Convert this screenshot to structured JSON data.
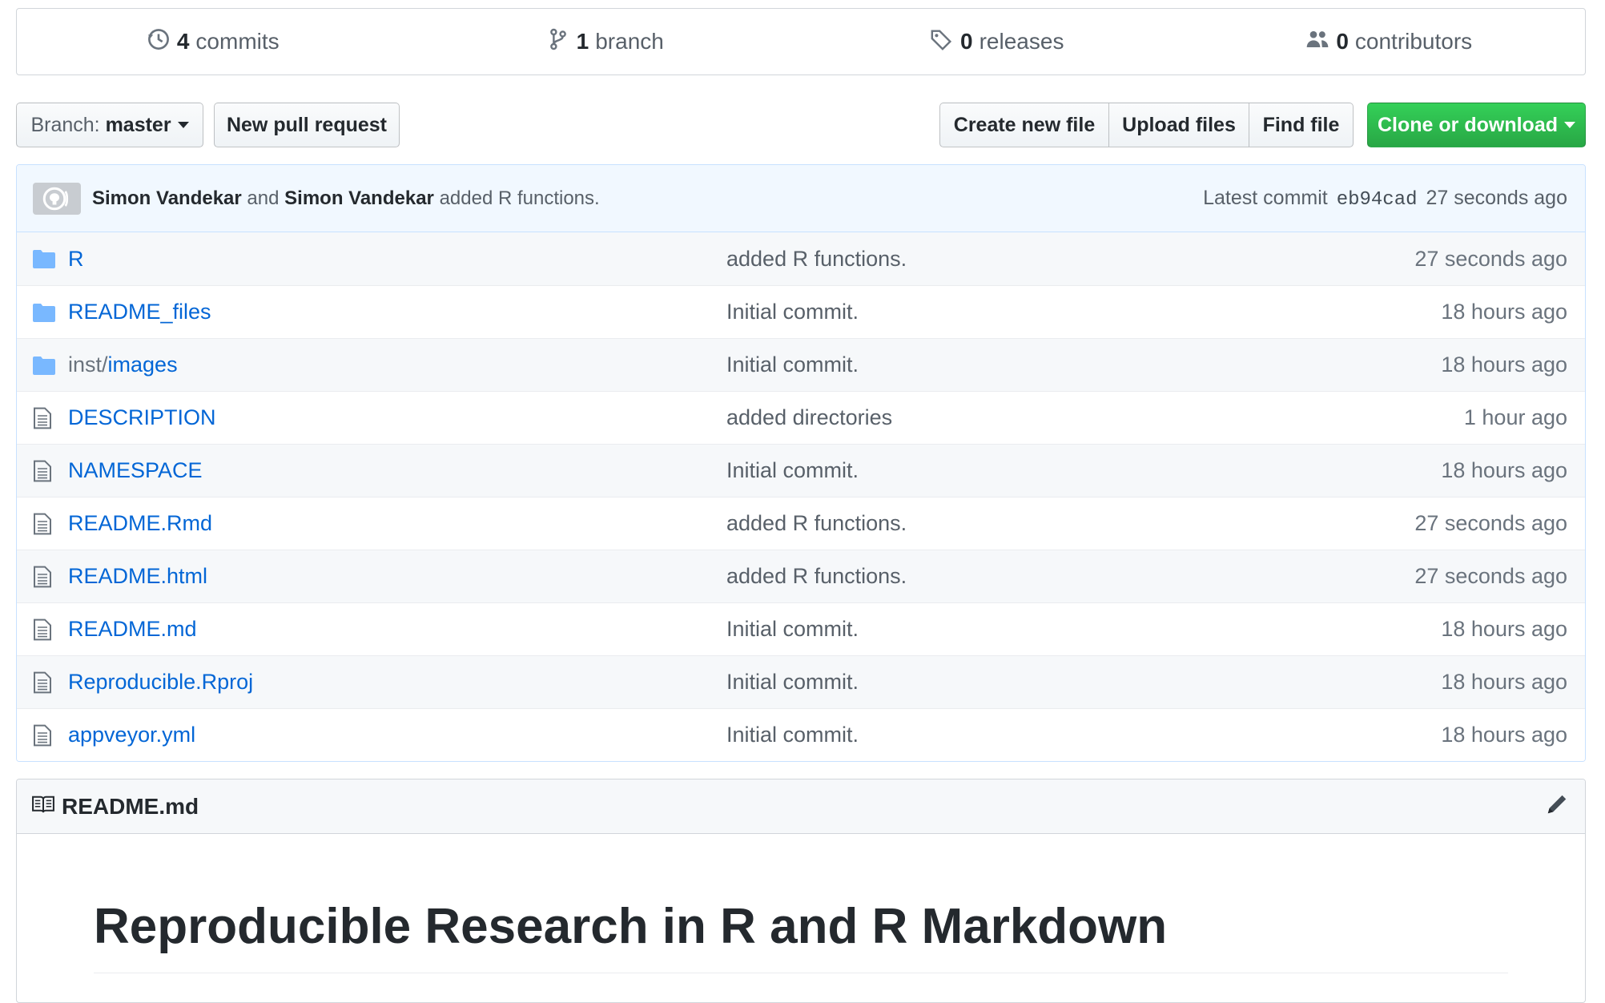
{
  "stats": {
    "commits": {
      "count": "4",
      "label": "commits"
    },
    "branches": {
      "count": "1",
      "label": "branch"
    },
    "releases": {
      "count": "0",
      "label": "releases"
    },
    "contributors": {
      "count": "0",
      "label": "contributors"
    }
  },
  "toolbar": {
    "branch_prefix": "Branch:",
    "branch_name": "master",
    "new_pull_request": "New pull request",
    "create_new_file": "Create new file",
    "upload_files": "Upload files",
    "find_file": "Find file",
    "clone_or_download": "Clone or download"
  },
  "latest_commit": {
    "author1": "Simon Vandekar",
    "conjunction": "and",
    "author2": "Simon Vandekar",
    "message": "added R functions.",
    "label": "Latest commit",
    "sha": "eb94cad",
    "age": "27 seconds ago"
  },
  "files": [
    {
      "type": "folder",
      "prefix": "",
      "name": "R",
      "message": "added R functions.",
      "age": "27 seconds ago"
    },
    {
      "type": "folder",
      "prefix": "",
      "name": "README_files",
      "message": "Initial commit.",
      "age": "18 hours ago"
    },
    {
      "type": "folder",
      "prefix": "inst/",
      "name": "images",
      "message": "Initial commit.",
      "age": "18 hours ago"
    },
    {
      "type": "file",
      "prefix": "",
      "name": "DESCRIPTION",
      "message": "added directories",
      "age": "1 hour ago"
    },
    {
      "type": "file",
      "prefix": "",
      "name": "NAMESPACE",
      "message": "Initial commit.",
      "age": "18 hours ago"
    },
    {
      "type": "file",
      "prefix": "",
      "name": "README.Rmd",
      "message": "added R functions.",
      "age": "27 seconds ago"
    },
    {
      "type": "file",
      "prefix": "",
      "name": "README.html",
      "message": "added R functions.",
      "age": "27 seconds ago"
    },
    {
      "type": "file",
      "prefix": "",
      "name": "README.md",
      "message": "Initial commit.",
      "age": "18 hours ago"
    },
    {
      "type": "file",
      "prefix": "",
      "name": "Reproducible.Rproj",
      "message": "Initial commit.",
      "age": "18 hours ago"
    },
    {
      "type": "file",
      "prefix": "",
      "name": "appveyor.yml",
      "message": "Initial commit.",
      "age": "18 hours ago"
    }
  ],
  "readme": {
    "filename": "README.md",
    "heading": "Reproducible Research in R and R Markdown"
  },
  "colors": {
    "link": "#0366d6",
    "clone_button": "#28a745",
    "commit_bar_bg": "#f1f8ff",
    "folder_icon": "#79b8ff"
  },
  "icons": {
    "commits": "history-icon",
    "branch": "git-branch-icon",
    "releases": "tag-icon",
    "contributors": "people-icon",
    "folder": "folder-icon",
    "file": "file-icon",
    "readme": "book-icon",
    "edit": "pencil-icon"
  }
}
